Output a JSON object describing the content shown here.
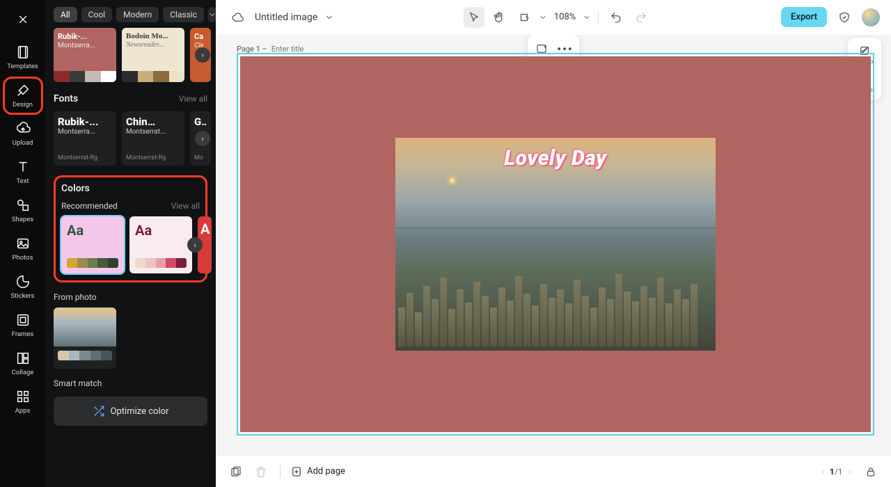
{
  "rail": {
    "logo": "✕",
    "items": [
      {
        "label": "Templates",
        "icon": "templates"
      },
      {
        "label": "Design",
        "icon": "design",
        "active": true
      },
      {
        "label": "Upload",
        "icon": "upload"
      },
      {
        "label": "Text",
        "icon": "text"
      },
      {
        "label": "Shapes",
        "icon": "shapes"
      },
      {
        "label": "Photos",
        "icon": "photos"
      },
      {
        "label": "Stickers",
        "icon": "stickers"
      },
      {
        "label": "Frames",
        "icon": "frames"
      },
      {
        "label": "Collage",
        "icon": "collage"
      },
      {
        "label": "Apps",
        "icon": "apps"
      }
    ]
  },
  "chips": {
    "items": [
      "All",
      "Cool",
      "Modern",
      "Classic"
    ],
    "active": 0,
    "more": true
  },
  "style_cards": [
    {
      "title": "Rubik-...",
      "sub": "Montserra...",
      "bg": "#b16560",
      "title_color": "#fff",
      "sub_color": "#eee",
      "swatches": [
        "#8e2b29",
        "#3a3a3a",
        "#c9b9b5",
        "#fff"
      ]
    },
    {
      "title": "Bodoin Mo...",
      "sub": "Newsreader...",
      "bg": "#efe6d2",
      "title_color": "#3b3b3b",
      "sub_color": "#7a7060",
      "swatches": [
        "#2b2b2b",
        "#c7ae7b",
        "#8a6c3e",
        "#ede1c4"
      ]
    },
    {
      "title": "Ca",
      "sub": "Cle",
      "bg": "#c75b2d",
      "title_color": "#fff",
      "sub_color": "#ffe0c4",
      "swatches": [
        "#7a2e12",
        "#e08a4a",
        "#f3c58e"
      ]
    }
  ],
  "fonts": {
    "heading": "Fonts",
    "view_all": "View all",
    "cards": [
      {
        "big": "Rubik-...",
        "mid": "Montserra...",
        "sm": "Montserrat-Rg"
      },
      {
        "big": "Chin…",
        "mid": "Montserrat...",
        "sm": "Montserrat-Rg"
      },
      {
        "big": "Gu",
        "mid": "",
        "sm": "Mo"
      }
    ]
  },
  "colors": {
    "heading": "Colors",
    "recommended": "Recommended",
    "view_all": "View all",
    "cards": [
      {
        "bg": "#f4c6ea",
        "aa_color": "#2f5a3e",
        "selected": true,
        "swatches": [
          "#d7a531",
          "#9a8b4f",
          "#6e7b4e",
          "#4a5a3a",
          "#2f4030"
        ]
      },
      {
        "bg": "#f9ecef",
        "aa_color": "#7a1e3e",
        "swatches": [
          "#f3d6ca",
          "#eec2bd",
          "#e79ea8",
          "#cc4a6a",
          "#7a1e3e"
        ]
      },
      {
        "bg": "#d83a3a",
        "aa_color": "#fff",
        "swatches": [
          "#b12828",
          "#d85a47",
          "#eecfc5"
        ]
      }
    ],
    "from_photo_label": "From photo",
    "from_photo_swatches": [
      "#d7c7a8",
      "#a9b7bb",
      "#79898e",
      "#5e6f74",
      "#45565a"
    ],
    "smart_match": "Smart match",
    "optimize": "Optimize color"
  },
  "topbar": {
    "title": "Untitled image",
    "zoom": "108%",
    "export": "Export"
  },
  "page": {
    "label": "Page 1 –",
    "placeholder": "Enter title",
    "lovely_text": "Lovely Day",
    "bg_color": "#b16560"
  },
  "right_tools": [
    {
      "label": "Backgro..",
      "icon": "background"
    },
    {
      "label": "Resize",
      "icon": "resize"
    }
  ],
  "bottombar": {
    "add_page": "Add page",
    "page_current": "1",
    "page_total": "1"
  }
}
